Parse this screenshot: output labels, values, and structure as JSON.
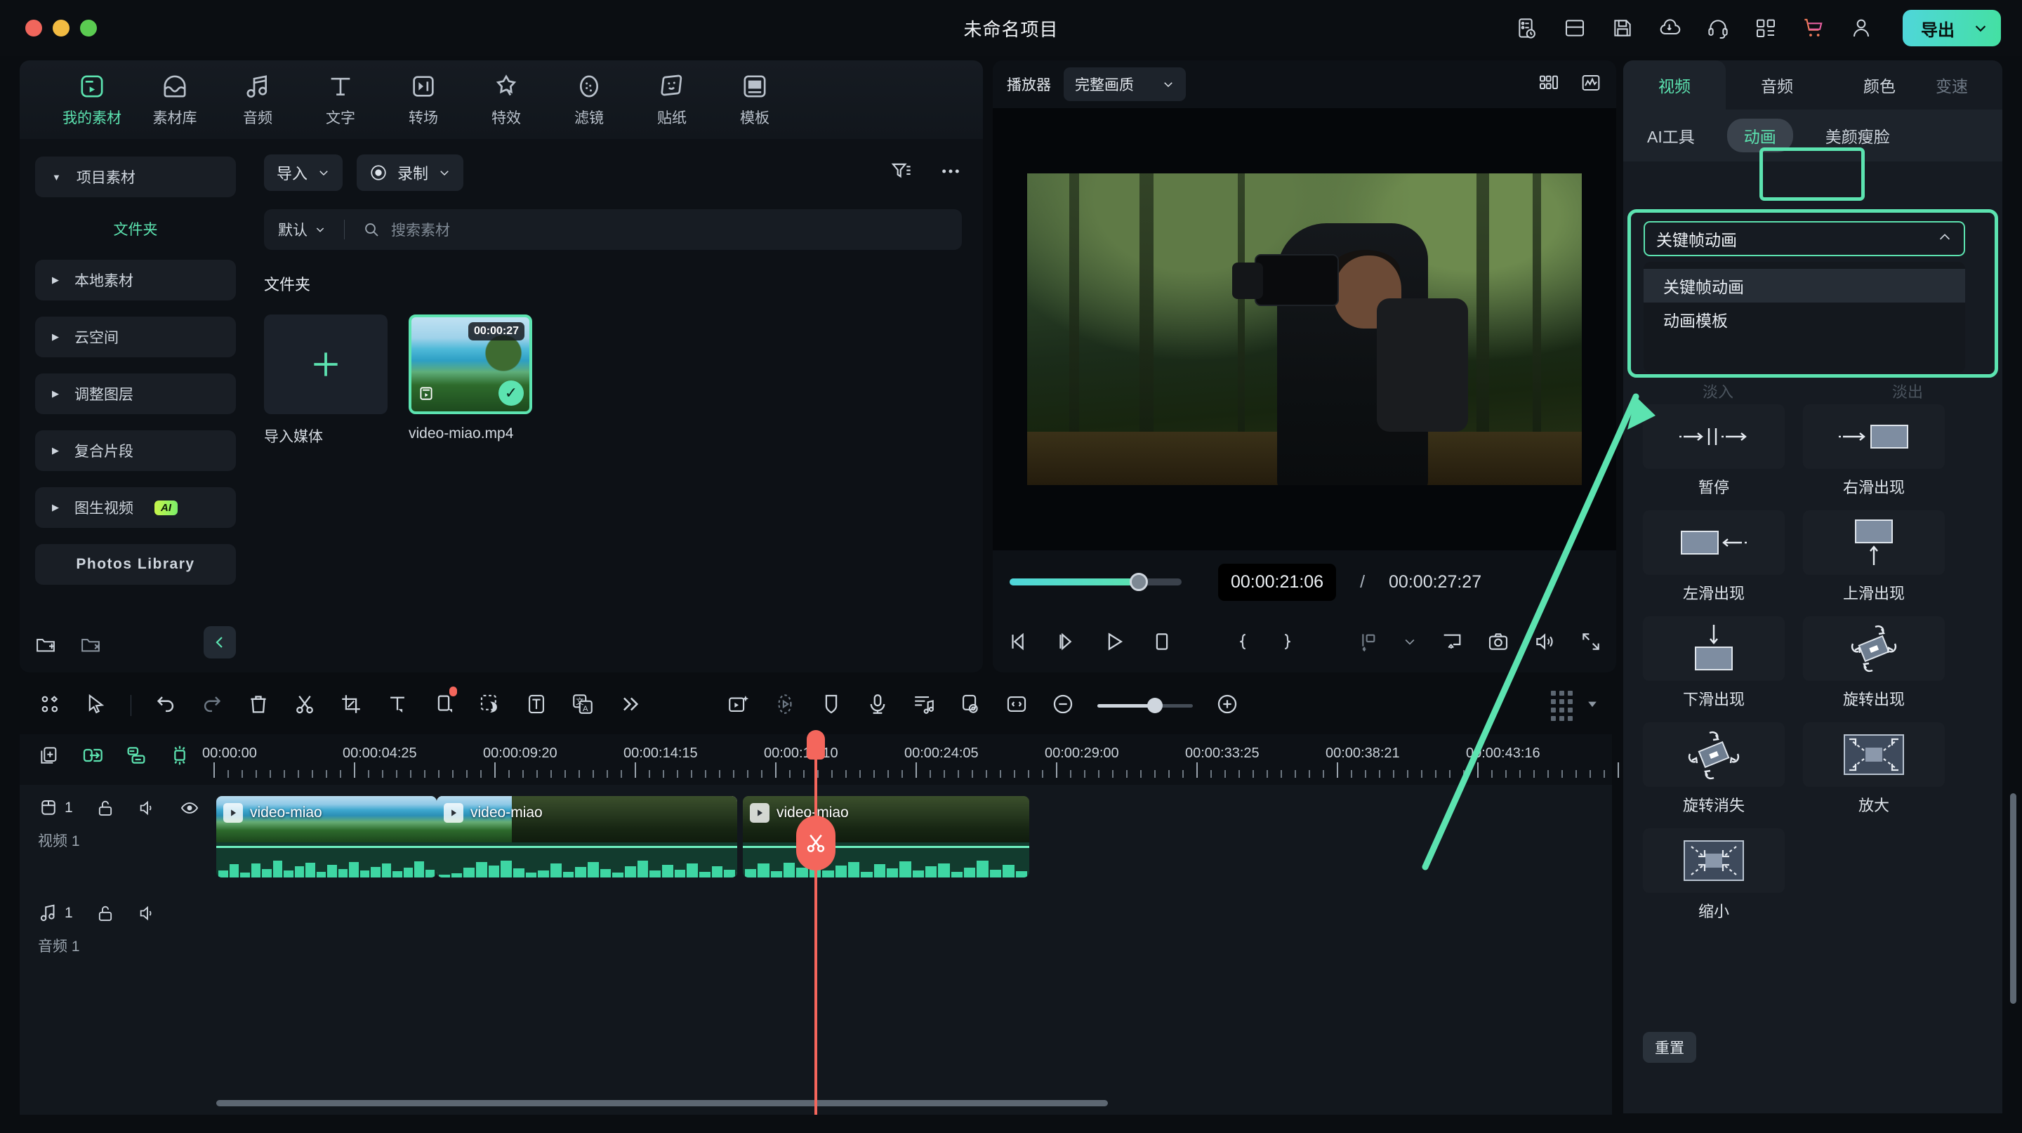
{
  "titlebar": {
    "project_title": "未命名项目",
    "export_label": "导出",
    "icons": [
      "task-list-clock-icon",
      "layout-icon",
      "save-icon",
      "cloud-upload-icon",
      "headset-support-icon",
      "apps-grid-icon",
      "shopping-cart-icon",
      "user-account-icon"
    ]
  },
  "nav_tabs": [
    {
      "label": "我的素材",
      "icon": "my-media-icon",
      "active": true
    },
    {
      "label": "素材库",
      "icon": "stock-library-icon",
      "active": false
    },
    {
      "label": "音频",
      "icon": "audio-icon",
      "active": false
    },
    {
      "label": "文字",
      "icon": "text-icon",
      "active": false
    },
    {
      "label": "转场",
      "icon": "transition-icon",
      "active": false
    },
    {
      "label": "特效",
      "icon": "effects-icon",
      "active": false
    },
    {
      "label": "滤镜",
      "icon": "filter-icon",
      "active": false
    },
    {
      "label": "贴纸",
      "icon": "sticker-icon",
      "active": false
    },
    {
      "label": "模板",
      "icon": "template-icon",
      "active": false
    }
  ],
  "sidebar": {
    "project_media": "项目素材",
    "folder_sub": "文件夹",
    "items": [
      {
        "label": "本地素材"
      },
      {
        "label": "云空间"
      },
      {
        "label": "调整图层"
      },
      {
        "label": "复合片段"
      },
      {
        "label": "图生视频",
        "badge": "AI"
      }
    ],
    "photos_library": "Photos Library",
    "footer_icons": [
      "new-folder-icon",
      "delete-folder-icon",
      "collapse-panel-icon"
    ]
  },
  "browser": {
    "import_label": "导入",
    "record_label": "录制",
    "filter_icon": "filter-sort-icon",
    "more_icon": "more-options-icon",
    "sort_label": "默认",
    "search_placeholder": "搜索素材",
    "section_title": "文件夹",
    "import_media_label": "导入媒体",
    "asset": {
      "name": "video-miao.mp4",
      "duration": "00:00:27"
    }
  },
  "player": {
    "label": "播放器",
    "quality": "完整画质",
    "right_icons": [
      "grid-view-icon",
      "waveform-scope-icon"
    ],
    "current_time": "00:00:21:06",
    "separator": "/",
    "total_time": "00:00:27:27",
    "progress_percent": 75,
    "controls": [
      "prev-frame-icon",
      "next-frame-icon",
      "play-icon",
      "stop-icon",
      "mark-in-icon",
      "mark-out-icon",
      "marker-icon",
      "chevron-down-icon",
      "screen-cast-icon",
      "snapshot-icon",
      "volume-icon",
      "fullscreen-icon"
    ]
  },
  "right_panel": {
    "tabs": [
      {
        "label": "视频",
        "active": true
      },
      {
        "label": "音频",
        "active": false
      },
      {
        "label": "颜色",
        "active": false
      },
      {
        "label": "变速",
        "active": false,
        "clipped": true
      }
    ],
    "subtabs": [
      {
        "label": "AI工具",
        "selected": false
      },
      {
        "label": "动画",
        "selected": true,
        "highlighted": true
      },
      {
        "label": "美颜瘦脸",
        "selected": false
      }
    ],
    "dropdown": {
      "selected": "关键帧动画",
      "open": true,
      "options": [
        {
          "label": "关键帧动画",
          "hovered": true
        },
        {
          "label": "动画模板",
          "hovered": false
        }
      ]
    },
    "hidden_labels": [
      "淡入",
      "淡出"
    ],
    "animations": [
      {
        "label": "暂停",
        "icon": "pause-between-arrows-icon"
      },
      {
        "label": "右滑出现",
        "icon": "slide-in-right-icon"
      },
      {
        "label": "左滑出现",
        "icon": "slide-in-left-icon"
      },
      {
        "label": "上滑出现",
        "icon": "slide-in-up-icon"
      },
      {
        "label": "下滑出现",
        "icon": "slide-in-down-icon"
      },
      {
        "label": "旋转出现",
        "icon": "rotate-in-icon"
      },
      {
        "label": "旋转消失",
        "icon": "rotate-out-icon"
      },
      {
        "label": "放大",
        "icon": "zoom-in-icon"
      },
      {
        "label": "缩小",
        "icon": "zoom-out-icon"
      }
    ],
    "reset_label": "重置"
  },
  "timeline": {
    "toolbar_left_icons": [
      "marker-tool-icon",
      "select-tool-icon"
    ],
    "toolbar_icons": [
      "undo-icon",
      "redo-icon",
      "delete-icon",
      "split-scissors-icon",
      "crop-icon",
      "text-tool-icon",
      "clip-tool-icon",
      "mask-icon",
      "auto-caption-icon",
      "translate-icon",
      "more-chevrons-icon"
    ],
    "toolbar_icons_right": [
      "ai-video-icon",
      "record-circle-icon",
      "shield-icon",
      "microphone-icon",
      "audio-mix-icon",
      "keyframe-icon",
      "fit-to-width-icon",
      "zoom-out-minus-icon",
      "zoom-in-plus-icon"
    ],
    "zoom_percent": 60,
    "ruler_icons": [
      "add-track-icon",
      "link-clips-icon",
      "group-clips-icon",
      "snap-magnet-icon"
    ],
    "ruler_labels": [
      "00:00:00",
      "00:00:04:25",
      "00:00:09:20",
      "00:00:14:15",
      "00:00:19:10",
      "00:00:24:05",
      "00:00:29:00",
      "00:00:33:25",
      "00:00:38:21",
      "00:00:43:16"
    ],
    "tracks": [
      {
        "type": "video",
        "num": "1",
        "name": "视频 1",
        "icons": [
          "video-track-icon",
          "unlock-icon",
          "speaker-icon",
          "eye-icon"
        ]
      },
      {
        "type": "audio",
        "num": "1",
        "name": "音频 1",
        "icons": [
          "audio-track-icon",
          "unlock-icon",
          "speaker-icon"
        ]
      }
    ],
    "clips": [
      {
        "title": "video-miao",
        "selected": false,
        "scene": "beach"
      },
      {
        "title": "video-miao",
        "selected": true,
        "scene": "mixed"
      },
      {
        "title": "video-miao",
        "selected": false,
        "scene": "forest"
      }
    ]
  },
  "colors": {
    "accent": "#5ce3b0",
    "playhead": "#f4665c",
    "panel_bg": "#161b22",
    "app_bg": "#0a0d11",
    "ai_badge": "#c8f54a"
  }
}
